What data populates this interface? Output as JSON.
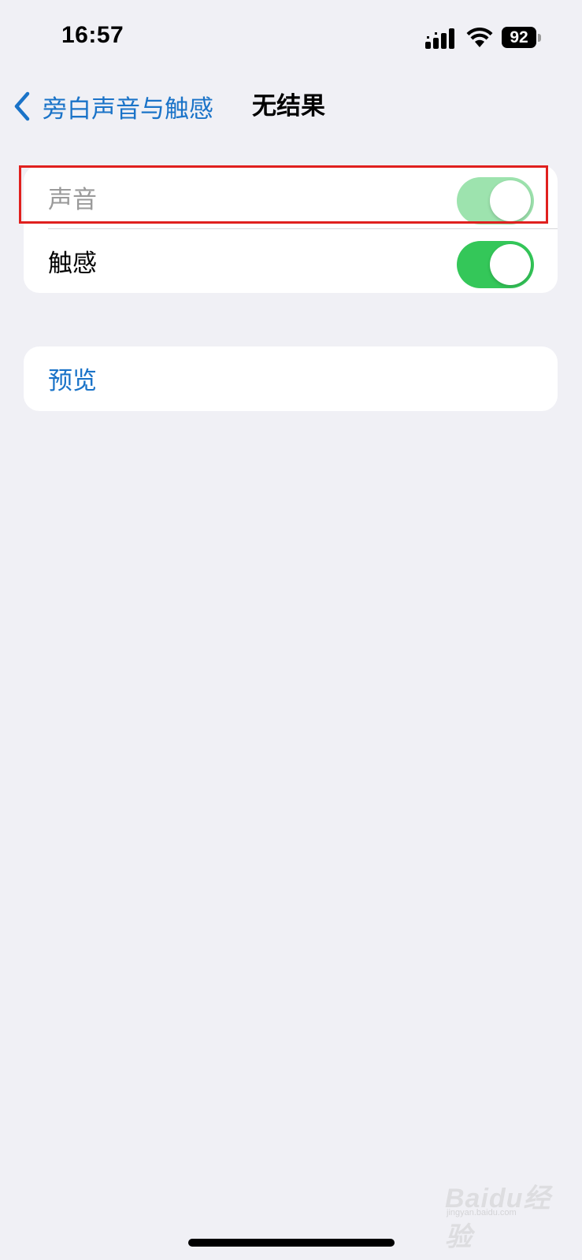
{
  "status_bar": {
    "time": "16:57",
    "signal_icon": "cellular-signal-icon",
    "wifi_icon": "wifi-icon",
    "battery_level": "92"
  },
  "nav": {
    "back_label": "旁白声音与触感",
    "title": "无结果"
  },
  "settings": {
    "rows": [
      {
        "label": "声音",
        "toggle_on": true,
        "disabled": true
      },
      {
        "label": "触感",
        "toggle_on": true,
        "disabled": false
      }
    ],
    "preview_label": "预览"
  },
  "colors": {
    "accent": "#1A73C8",
    "toggle_on": "#34C759",
    "toggle_disabled": "#9DE3AE",
    "highlight": "#E0201E",
    "background": "#F0F0F5"
  },
  "watermark": {
    "text": "Baidu经验",
    "sub": "jingyan.baidu.com"
  }
}
